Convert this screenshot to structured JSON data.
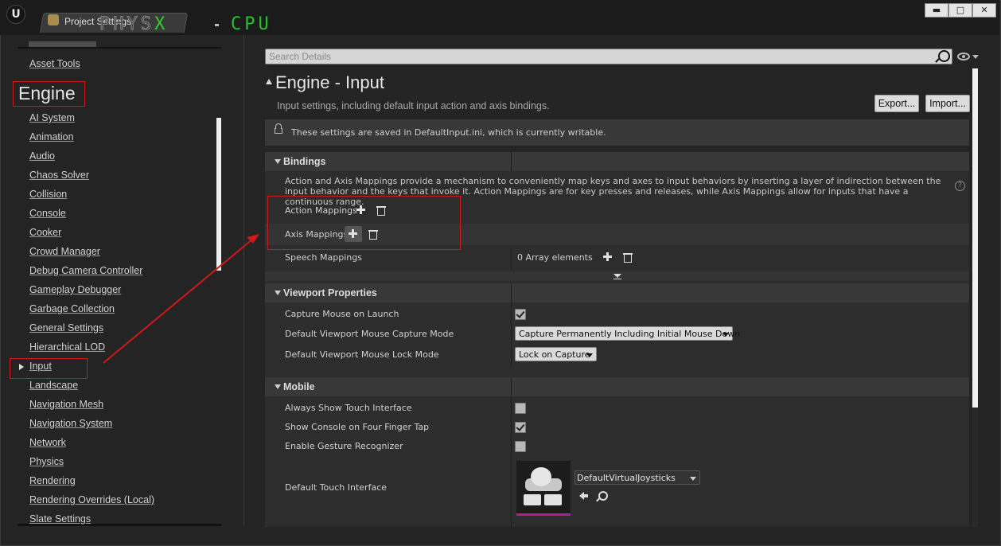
{
  "titlebar": {
    "tab_label": "Project Settings",
    "overlay_physx": "PHYS",
    "overlay_x": "X",
    "overlay_cpu": "CPU",
    "buttons": {
      "minimize": "▬",
      "maximize": "□",
      "close": "✕"
    }
  },
  "sidebar": {
    "items": [
      "Asset Tools",
      "AI System",
      "Animation",
      "Audio",
      "Chaos Solver",
      "Collision",
      "Console",
      "Cooker",
      "Crowd Manager",
      "Debug Camera Controller",
      "Gameplay Debugger",
      "Garbage Collection",
      "General Settings",
      "Hierarchical LOD",
      "Input",
      "Landscape",
      "Navigation Mesh",
      "Navigation System",
      "Network",
      "Physics",
      "Rendering",
      "Rendering Overrides (Local)",
      "Slate Settings"
    ],
    "section_title": "Engine",
    "selected": "Input"
  },
  "search": {
    "placeholder": "Search Details"
  },
  "header": {
    "title": "Engine - Input",
    "subtitle": "Input settings, including default input action and axis bindings.",
    "export_label": "Export...",
    "import_label": "Import..."
  },
  "notice": {
    "text": "These settings are saved in DefaultInput.ini, which is currently writable."
  },
  "bindings": {
    "title": "Bindings",
    "description": "Action and Axis Mappings provide a mechanism to conveniently map keys and axes to input behaviors by inserting a layer of indirection between the input behavior and the keys that invoke it. Action Mappings are for key presses and releases, while Axis Mappings allow for inputs that have a continuous range.",
    "action_mappings": "Action Mappings",
    "axis_mappings": "Axis Mappings",
    "speech_mappings": "Speech Mappings",
    "speech_value": "0 Array elements"
  },
  "viewport": {
    "title": "Viewport Properties",
    "capture_on_launch": "Capture Mouse on Launch",
    "capture_on_launch_checked": true,
    "capture_mode_label": "Default Viewport Mouse Capture Mode",
    "capture_mode_value": "Capture Permanently Including Initial Mouse Down",
    "lock_mode_label": "Default Viewport Mouse Lock Mode",
    "lock_mode_value": "Lock on Capture"
  },
  "mobile": {
    "title": "Mobile",
    "always_show_touch": "Always Show Touch Interface",
    "always_show_touch_checked": false,
    "show_console": "Show Console on Four Finger Tap",
    "show_console_checked": true,
    "gesture": "Enable Gesture Recognizer",
    "gesture_checked": false,
    "touch_interface_label": "Default Touch Interface",
    "touch_interface_value": "DefaultVirtualJoysticks"
  },
  "colors": {
    "annotation_red": "#d01818",
    "accent_magenta": "#b0208a",
    "physx_green": "#27c227"
  }
}
